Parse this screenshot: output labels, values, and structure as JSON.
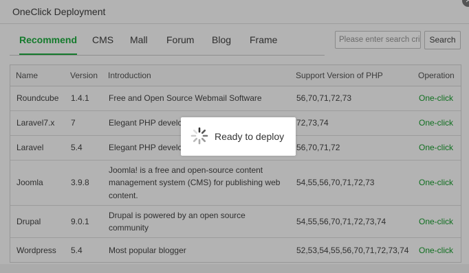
{
  "dialog": {
    "title": "OneClick Deployment"
  },
  "tabs": [
    {
      "label": "Recommend",
      "active": true
    },
    {
      "label": "CMS"
    },
    {
      "label": "Mall"
    },
    {
      "label": "Forum"
    },
    {
      "label": "Blog"
    },
    {
      "label": "Frame"
    }
  ],
  "search": {
    "placeholder": "Please enter search crit",
    "button_label": "Search"
  },
  "table": {
    "columns": [
      "Name",
      "Version",
      "Introduction",
      "Support Version of PHP",
      "Operation"
    ],
    "rows": [
      {
        "name": "Roundcube",
        "version": "1.4.1",
        "intro": "Free and Open Source Webmail Software",
        "php": "56,70,71,72,73",
        "op": "One-click"
      },
      {
        "name": "Laravel7.x",
        "version": "7",
        "intro": "Elegant PHP develc",
        "php": "72,73,74",
        "op": "One-click"
      },
      {
        "name": "Laravel",
        "version": "5.4",
        "intro": "Elegant PHP develc",
        "php": "56,70,71,72",
        "op": "One-click"
      },
      {
        "name": "Joomla",
        "version": "3.9.8",
        "intro": "Joomla! is a free and open-source content management system (CMS) for publishing web content.",
        "php": "54,55,56,70,71,72,73",
        "op": "One-click"
      },
      {
        "name": "Drupal",
        "version": "9.0.1",
        "intro": "Drupal is powered by an open source community",
        "php": "54,55,56,70,71,72,73,74",
        "op": "One-click"
      },
      {
        "name": "Wordpress",
        "version": "5.4",
        "intro": "Most popular blogger",
        "php": "52,53,54,55,56,70,71,72,73,74",
        "op": "One-click"
      }
    ]
  },
  "loading": {
    "text": "Ready to deploy"
  },
  "colors": {
    "accent": "#147a2c",
    "overlay": "#b3b3b3"
  }
}
